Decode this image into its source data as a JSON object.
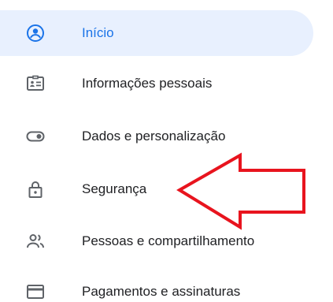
{
  "nav": {
    "items": [
      {
        "label": "Início",
        "icon": "account-circle-icon",
        "active": true
      },
      {
        "label": "Informações pessoais",
        "icon": "id-card-icon",
        "active": false
      },
      {
        "label": "Dados e personalização",
        "icon": "toggle-icon",
        "active": false
      },
      {
        "label": "Segurança",
        "icon": "lock-icon",
        "active": false
      },
      {
        "label": "Pessoas e compartilhamento",
        "icon": "people-icon",
        "active": false
      },
      {
        "label": "Pagamentos e assinaturas",
        "icon": "credit-card-icon",
        "active": false
      }
    ]
  },
  "colors": {
    "accent": "#1a73e8",
    "active_bg": "#e8f0fe",
    "text": "#202124",
    "icon": "#5f6368",
    "annotation_arrow": "#e8141e"
  }
}
